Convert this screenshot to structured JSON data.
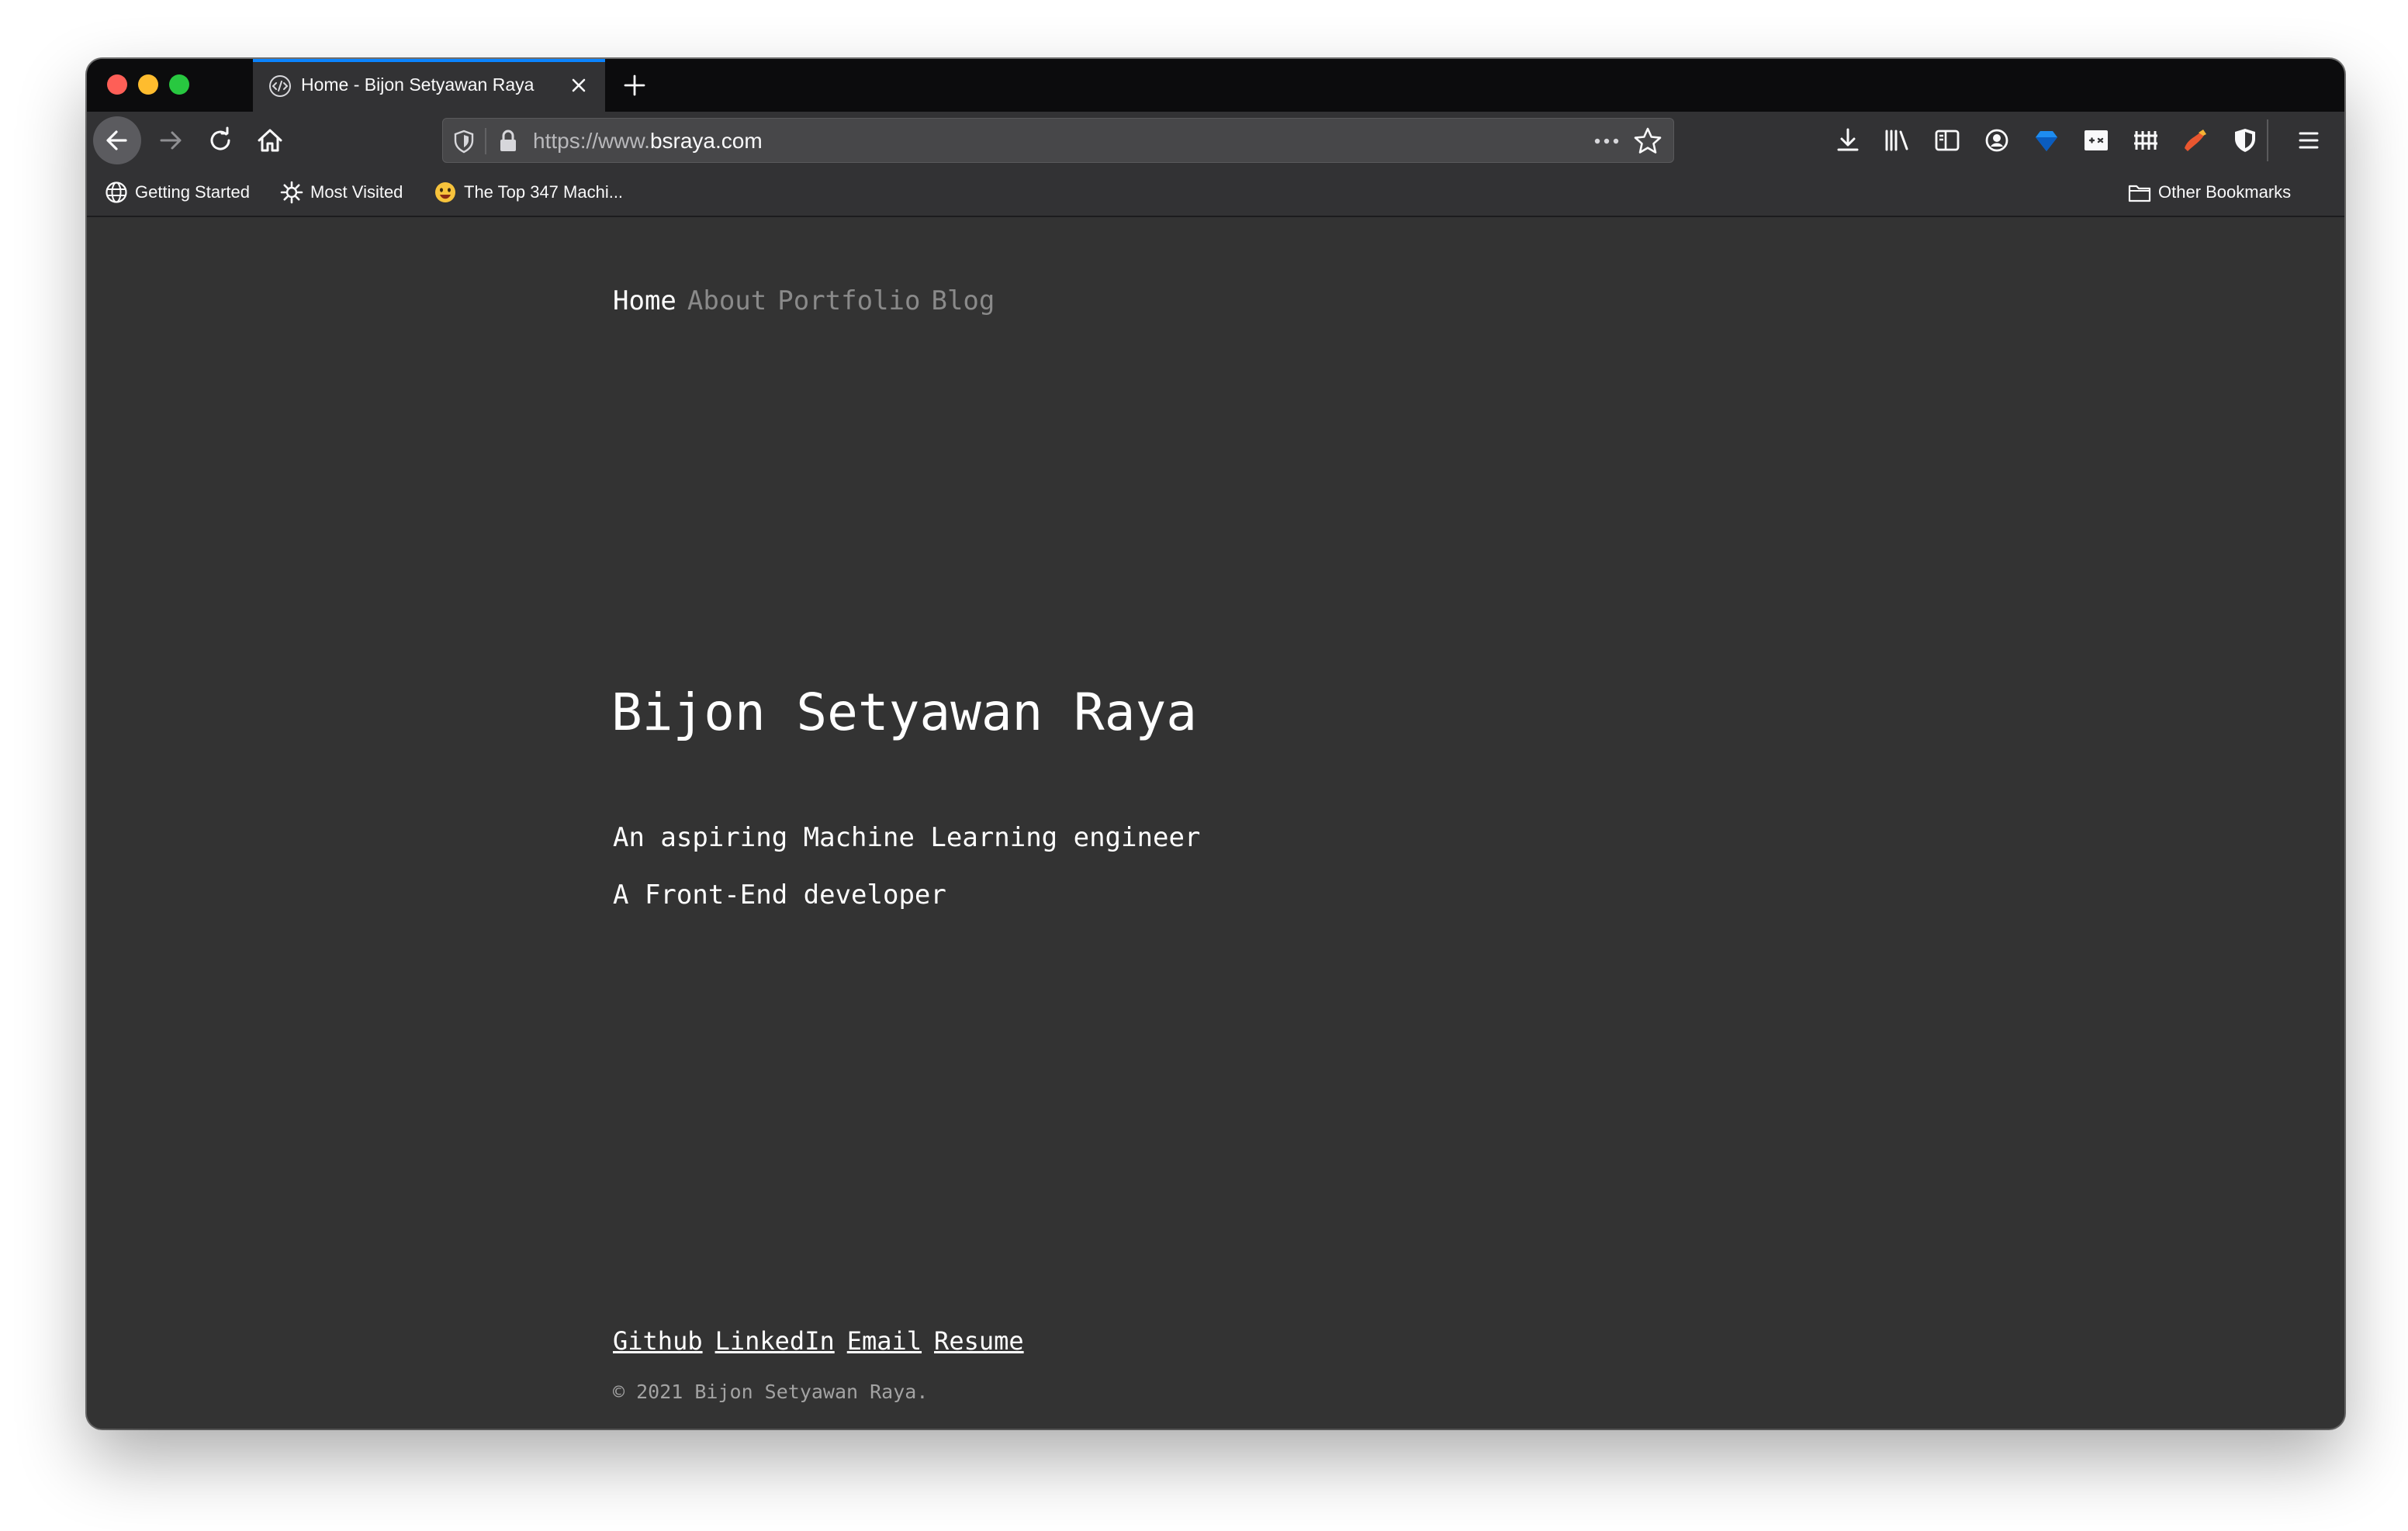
{
  "browser": {
    "tab": {
      "title": "Home - Bijon Setyawan Raya",
      "favicon": "code-icon"
    },
    "url": {
      "scheme_prefix": "https://www.",
      "host": "bsraya.com"
    },
    "bookmarks": [
      {
        "label": "Getting Started",
        "icon": "globe-icon"
      },
      {
        "label": "Most Visited",
        "icon": "gear-icon"
      },
      {
        "label": "The Top 347 Machi...",
        "icon": "emoji-icon"
      }
    ],
    "other_bookmarks": {
      "label": "Other Bookmarks",
      "icon": "folder-icon"
    }
  },
  "page": {
    "nav": [
      "Home",
      "About",
      "Portfolio",
      "Blog"
    ],
    "name": "Bijon Setyawan Raya",
    "taglines": [
      "An aspiring Machine Learning engineer",
      "A Front-End developer"
    ],
    "footer_links": [
      "Github",
      "LinkedIn",
      "Email",
      "Resume"
    ],
    "copyright": "© 2021 Bijon Setyawan Raya."
  },
  "colors": {
    "page_background": "#333333",
    "chrome_dark": "#0c0c0d",
    "toolbar": "#323234",
    "active_tab_accent": "#0a84ff",
    "nav_inactive": "#8a8a8a",
    "text": "#ffffff"
  }
}
